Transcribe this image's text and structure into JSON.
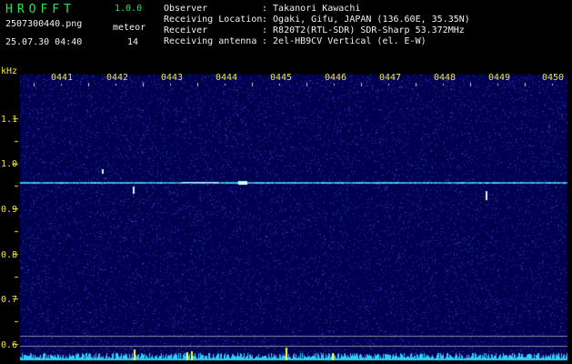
{
  "app": {
    "logo_text": "HROFFT",
    "version": "1.0.0"
  },
  "file": {
    "name": "2507300440.png",
    "datetime": "25.07.30 04:40"
  },
  "meteor": {
    "label": "meteor",
    "count": "14"
  },
  "info": [
    {
      "label": "Observer",
      "value": ": Takanori Kawachi"
    },
    {
      "label": "Receiving Location",
      "value": ": Ogaki, Gifu, JAPAN (136.60E, 35.35N)"
    },
    {
      "label": "Receiver",
      "value": ": R820T2(RTL-SDR) SDR-Sharp 53.372MHz"
    },
    {
      "label": "Receiving antenna",
      "value": ": 2el-HB9CV Vertical (el. E-W)"
    }
  ],
  "axis": {
    "unit": "kHz",
    "time_ticks": [
      "0441",
      "0442",
      "0443",
      "0444",
      "0445",
      "0446",
      "0447",
      "0448",
      "0449",
      "0450"
    ],
    "freq_ticks": [
      "1.1",
      "1.0",
      "0.9",
      "0.8",
      "0.7",
      "0.6"
    ]
  },
  "colors": {
    "green": "#22e64a",
    "yellow": "#f0e63c",
    "trace": "#4de0ff",
    "noise_bg": "#0a0a78"
  }
}
